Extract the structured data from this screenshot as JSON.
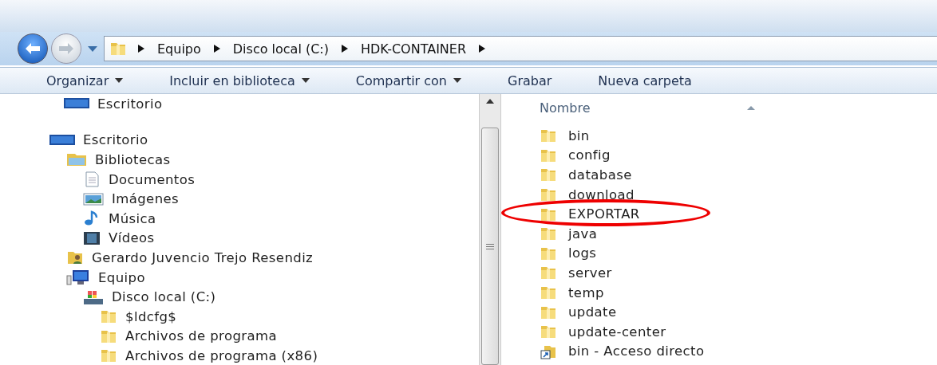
{
  "address_bar": {
    "path": [
      "Equipo",
      "Disco local (C:)",
      "HDK-CONTAINER"
    ]
  },
  "toolbar": [
    {
      "label": "Organizar",
      "has_menu": true
    },
    {
      "label": "Incluir en biblioteca",
      "has_menu": true
    },
    {
      "label": "Compartir con",
      "has_menu": true
    },
    {
      "label": "Grabar",
      "has_menu": false
    },
    {
      "label": "Nueva carpeta",
      "has_menu": false
    }
  ],
  "favorites": [
    {
      "label": "Escritorio",
      "kind": "desktop"
    }
  ],
  "tree": [
    {
      "label": "Escritorio",
      "kind": "desktop",
      "children": [
        {
          "label": "Bibliotecas",
          "kind": "library",
          "children": [
            {
              "label": "Documentos",
              "kind": "document"
            },
            {
              "label": "Imágenes",
              "kind": "images"
            },
            {
              "label": "Música",
              "kind": "music"
            },
            {
              "label": "Vídeos",
              "kind": "videos"
            }
          ]
        },
        {
          "label": "Gerardo Juvencio Trejo Resendiz",
          "kind": "user"
        },
        {
          "label": "Equipo",
          "kind": "computer",
          "children": [
            {
              "label": "Disco local (C:)",
              "kind": "drive",
              "children": [
                {
                  "label": "$ldcfg$",
                  "kind": "folder"
                },
                {
                  "label": "Archivos de programa",
                  "kind": "folder"
                },
                {
                  "label": "Archivos de programa (x86)",
                  "kind": "folder"
                }
              ]
            }
          ]
        }
      ]
    }
  ],
  "file_list": {
    "column": "Nombre",
    "items": [
      {
        "name": "bin",
        "kind": "folder",
        "circled": false
      },
      {
        "name": "config",
        "kind": "folder",
        "circled": false
      },
      {
        "name": "database",
        "kind": "folder",
        "circled": false
      },
      {
        "name": "download",
        "kind": "folder",
        "circled": false
      },
      {
        "name": "EXPORTAR",
        "kind": "folder",
        "circled": true
      },
      {
        "name": "java",
        "kind": "folder",
        "circled": false
      },
      {
        "name": "logs",
        "kind": "folder",
        "circled": false
      },
      {
        "name": "server",
        "kind": "folder",
        "circled": false
      },
      {
        "name": "temp",
        "kind": "folder",
        "circled": false
      },
      {
        "name": "update",
        "kind": "folder",
        "circled": false
      },
      {
        "name": "update-center",
        "kind": "folder",
        "circled": false
      },
      {
        "name": "bin - Acceso directo",
        "kind": "shortcut",
        "circled": false
      }
    ]
  }
}
